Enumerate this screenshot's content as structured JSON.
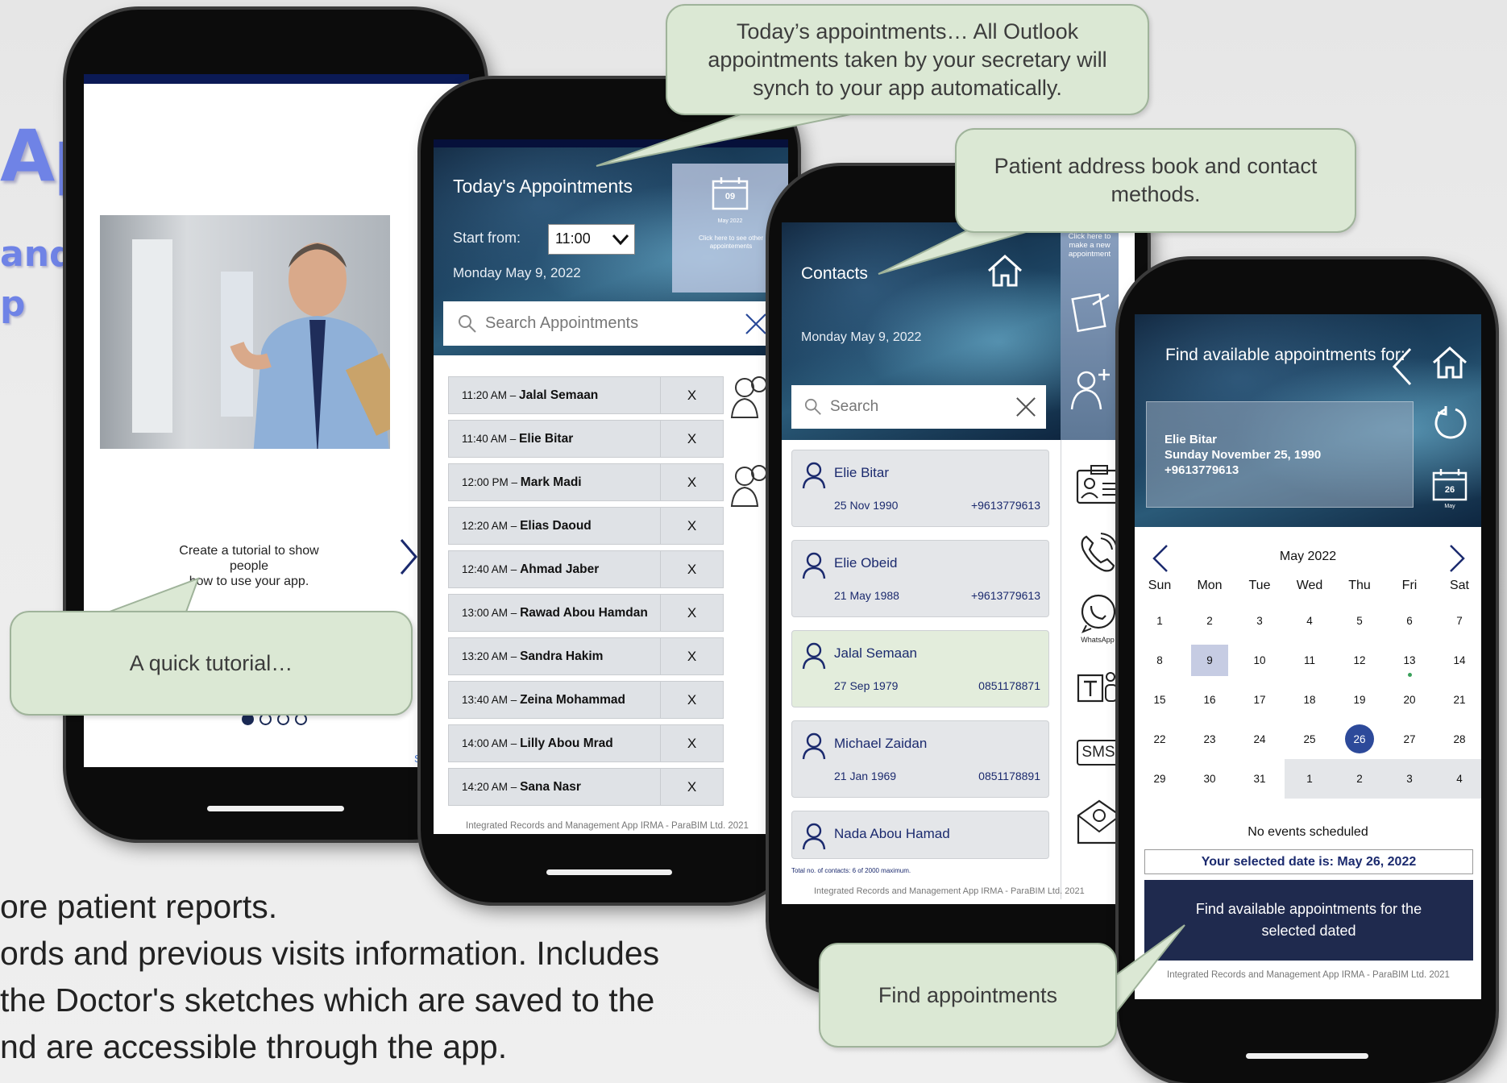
{
  "slide": {
    "title": "Apps",
    "subtitle_line1": "and",
    "subtitle_line2": "p",
    "body_lines": [
      "ore patient reports.",
      "ords and previous visits information. Includes",
      " the Doctor's sketches which are saved to the",
      "nd are accessible through the app."
    ]
  },
  "callouts": {
    "tutorial": "A quick tutorial…",
    "appointments": "Today’s appointments… All Outlook appointments taken by your secretary will synch to your app automatically.",
    "contacts": "Patient address book and contact methods.",
    "find": "Find appointments"
  },
  "tutorial_screen": {
    "caption_line1": "Create a tutorial to show people",
    "caption_line2": "how to use your app.",
    "skip_fragment": "S"
  },
  "appointments_screen": {
    "title": "Today's Appointments",
    "start_label": "Start from:",
    "start_value": "11:00",
    "date": "Monday May 9, 2022",
    "calendar_day": "09",
    "calendar_month": "May 2022",
    "calendar_hint": "Click here to see other appointements",
    "search_placeholder": "Search Appointments",
    "remove_label": "X",
    "items": [
      {
        "time": "11:20 AM – ",
        "name": "Jalal Semaan"
      },
      {
        "time": "11:40 AM – ",
        "name": "Elie Bitar"
      },
      {
        "time": "12:00 PM – ",
        "name": "Mark Madi"
      },
      {
        "time": "12:20 AM – ",
        "name": "Elias Daoud"
      },
      {
        "time": "12:40 AM – ",
        "name": "Ahmad Jaber"
      },
      {
        "time": "13:00 AM – ",
        "name": "Rawad Abou Hamdan"
      },
      {
        "time": "13:20 AM – ",
        "name": "Sandra Hakim"
      },
      {
        "time": "13:40 AM – ",
        "name": "Zeina Mohammad"
      },
      {
        "time": "14:00 AM – ",
        "name": "Lilly Abou Mrad"
      },
      {
        "time": "14:20 AM – ",
        "name": "Sana Nasr"
      }
    ],
    "footer": "Integrated Records and Management App IRMA - ParaBIM Ltd. 2021"
  },
  "contacts_screen": {
    "title": "Contacts",
    "date": "Monday May 9, 2022",
    "new_appt_hint": "Click here to make a new appointment",
    "search_placeholder": "Search",
    "contacts": [
      {
        "name": "Elie Bitar",
        "dob": "25 Nov 1990",
        "phone": "+9613779613"
      },
      {
        "name": "Elie Obeid",
        "dob": "21 May 1988",
        "phone": "+9613779613"
      },
      {
        "name": "Jalal Semaan",
        "dob": "27 Sep 1979",
        "phone": "0851178871"
      },
      {
        "name": "Michael Zaidan",
        "dob": "21 Jan 1969",
        "phone": "0851178891"
      },
      {
        "name": "Nada Abou Hamad",
        "dob": "",
        "phone": ""
      }
    ],
    "whatsapp_label": "WhatsApp",
    "sms_label": "SMS",
    "total_note": "Total no. of contacts: 6 of 2000 maximum.",
    "footer": "Integrated Records and Management App IRMA - ParaBIM Ltd. 2021"
  },
  "find_screen": {
    "title": "Find available appointments for:",
    "patient_name": "Elie Bitar",
    "patient_dob": "Sunday November 25, 1990",
    "patient_phone": "+9613779613",
    "cal_icon_day": "26",
    "cal_icon_month": "May",
    "month_label": "May 2022",
    "weekdays": [
      "Sun",
      "Mon",
      "Tue",
      "Wed",
      "Thu",
      "Fri",
      "Sat"
    ],
    "weeks": [
      [
        "1",
        "2",
        "3",
        "4",
        "5",
        "6",
        "7"
      ],
      [
        "8",
        "9",
        "10",
        "11",
        "12",
        "13",
        "14"
      ],
      [
        "15",
        "16",
        "17",
        "18",
        "19",
        "20",
        "21"
      ],
      [
        "22",
        "23",
        "24",
        "25",
        "26",
        "27",
        "28"
      ],
      [
        "29",
        "30",
        "31",
        "1",
        "2",
        "3",
        "4"
      ]
    ],
    "today": "9",
    "selected": "26",
    "event_day": "13",
    "no_events": "No events scheduled",
    "selected_text": "Your selected date is: May 26, 2022",
    "find_button": "Find available appointments for the selected dated",
    "footer": "Integrated Records and Management App IRMA - ParaBIM Ltd. 2021"
  }
}
